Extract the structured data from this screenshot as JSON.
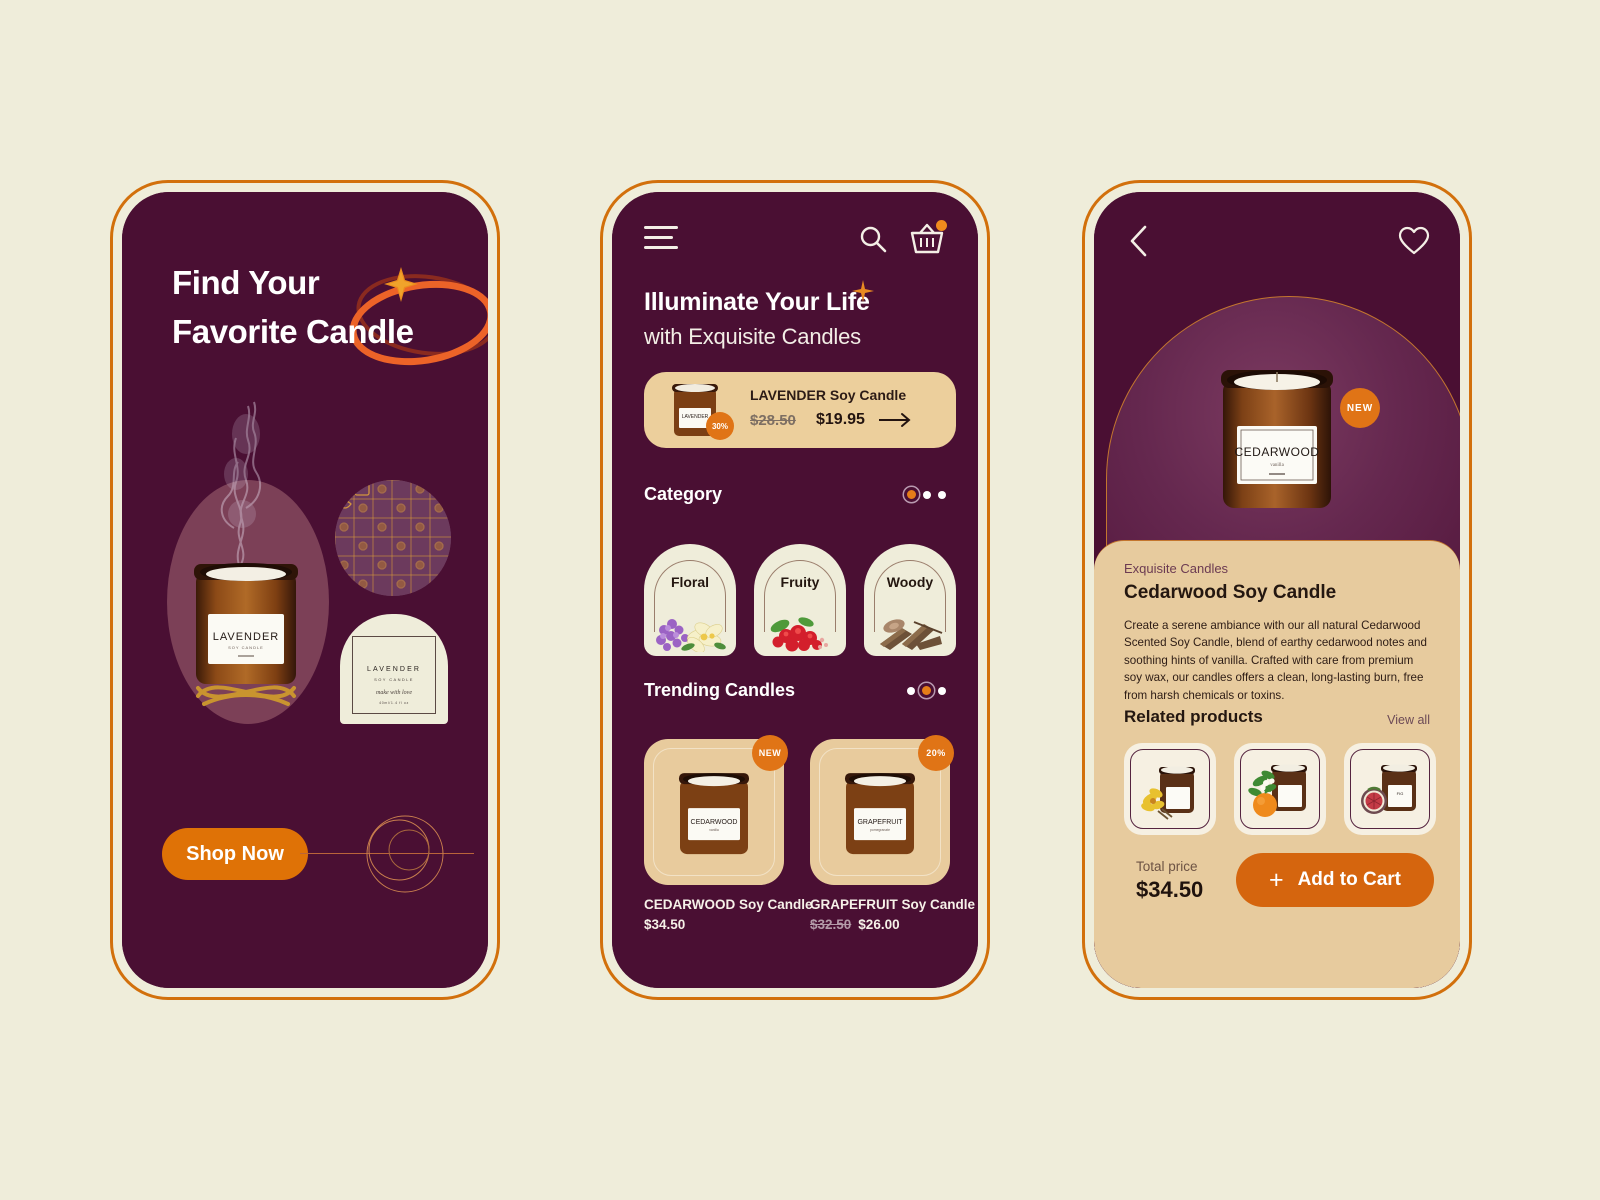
{
  "theme": {
    "page_bg": "#efedda",
    "screen_bg": "#4a0f33",
    "accent_orange": "#df7206",
    "panel_tan": "#e7cb9e",
    "cream": "#efedda"
  },
  "screen1": {
    "headline_line1": "Find Your",
    "headline_line2": "Favorite",
    "headline_highlight": "Candle",
    "hero_product_label": "LAVENDER",
    "label_card": {
      "name": "LAVENDER",
      "subtitle": "SOY CANDLE",
      "script": "make with love",
      "size": "40ml/1.4 fl oz"
    },
    "cta_label": "Shop Now"
  },
  "screen2": {
    "title_line1": "Illuminate Your Life",
    "title_line2": "with Exquisite Candles",
    "promo": {
      "name": "LAVENDER Soy Candle",
      "old_price": "$28.50",
      "new_price": "$19.95",
      "discount_badge": "30%"
    },
    "category": {
      "heading": "Category",
      "active_dot": 0,
      "dot_count": 3,
      "items": [
        {
          "label": "Floral",
          "icon": "floral-icon"
        },
        {
          "label": "Fruity",
          "icon": "fruity-icon"
        },
        {
          "label": "Woody",
          "icon": "woody-icon"
        }
      ]
    },
    "trending": {
      "heading": "Trending Candles",
      "active_dot": 1,
      "dot_count": 3,
      "items": [
        {
          "badge": "NEW",
          "jar_label": "CEDARWOOD",
          "name": "CEDARWOOD Soy Candle",
          "old_price": "",
          "price": "$34.50"
        },
        {
          "badge": "20%",
          "jar_label": "GRAPEFRUIT",
          "name": "GRAPEFRUIT Soy Candle",
          "old_price": "$32.50",
          "price": "$26.00"
        }
      ]
    }
  },
  "screen3": {
    "badge": "NEW",
    "jar_label": "CEDARWOOD",
    "jar_sub": "vanilla",
    "brand": "Exquisite Candles",
    "product_title": "Cedarwood Soy Candle",
    "description": "Create a serene ambiance with our all natural Cedarwood Scented Soy Candle, blend of earthy cedarwood notes and soothing hints of vanilla. Crafted with care from premium soy wax, our candles offers a clean, long-lasting burn, free from harsh chemicals or toxins.",
    "related_heading": "Related products",
    "view_all": "View all",
    "related_items": [
      {
        "icon": "vanilla-flower-icon"
      },
      {
        "icon": "orange-blossom-icon"
      },
      {
        "icon": "fig-icon"
      }
    ],
    "total_label": "Total price",
    "total_price": "$34.50",
    "add_to_cart": "Add to Cart",
    "plus": "+"
  }
}
